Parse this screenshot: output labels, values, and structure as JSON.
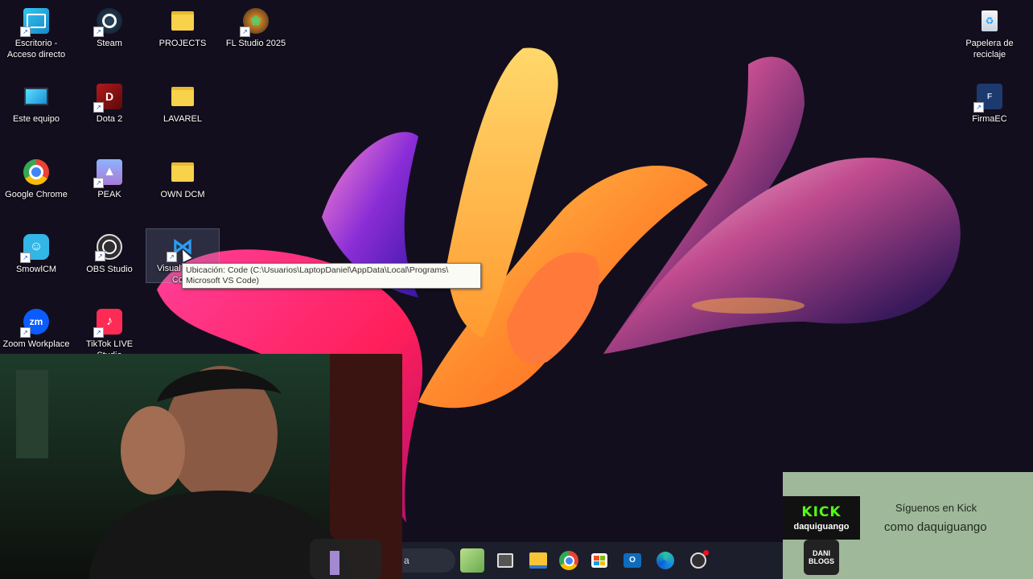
{
  "desktop": {
    "icons": [
      {
        "label": "Escritorio - Acceso directo",
        "icon": "desktop-shortcut-icon"
      },
      {
        "label": "Steam",
        "icon": "steam-icon"
      },
      {
        "label": "PROJECTS",
        "icon": "folder-icon"
      },
      {
        "label": "FL Studio 2025",
        "icon": "fl-studio-icon"
      },
      {
        "label": "Este equipo",
        "icon": "computer-icon"
      },
      {
        "label": "Dota 2",
        "icon": "dota2-icon"
      },
      {
        "label": "LAVAREL",
        "icon": "folder-icon"
      },
      {
        "label": "Google Chrome",
        "icon": "chrome-icon"
      },
      {
        "label": "PEAK",
        "icon": "peak-icon"
      },
      {
        "label": "OWN DCM",
        "icon": "folder-icon"
      },
      {
        "label": "SmowlCM",
        "icon": "smowl-icon"
      },
      {
        "label": "OBS Studio",
        "icon": "obs-icon"
      },
      {
        "label": "Visual Studio Code",
        "icon": "vscode-icon"
      },
      {
        "label": "Zoom Workplace",
        "icon": "zoom-icon"
      },
      {
        "label": "TikTok LIVE Studio",
        "icon": "tiktok-icon"
      },
      {
        "label": "Papelera de reciclaje",
        "icon": "recycle-bin-icon"
      },
      {
        "label": "FirmaEC",
        "icon": "firmaec-icon"
      }
    ],
    "tooltip_line1": "Ubicación: Code (C:\\Usuarios\\LaptopDaniel\\AppData\\Local\\Programs\\",
    "tooltip_line2": "Microsoft VS Code)"
  },
  "taskbar": {
    "search_text": "a",
    "apps": [
      "widgets-icon",
      "task-view-icon",
      "file-explorer-icon",
      "chrome-icon",
      "microsoft-store-icon",
      "outlook-icon",
      "edge-icon",
      "obs-icon"
    ]
  },
  "overlay": {
    "kick_logo": "KICK",
    "kick_user": "daquiguango",
    "line1": "Síguenos en Kick",
    "line2": "como daquiguango",
    "badge": "DANI BLOGS"
  },
  "colors": {
    "kick_green": "#53fc18",
    "overlay_bg": "#9fb89a",
    "taskbar_bg": "#1c1f2b"
  }
}
